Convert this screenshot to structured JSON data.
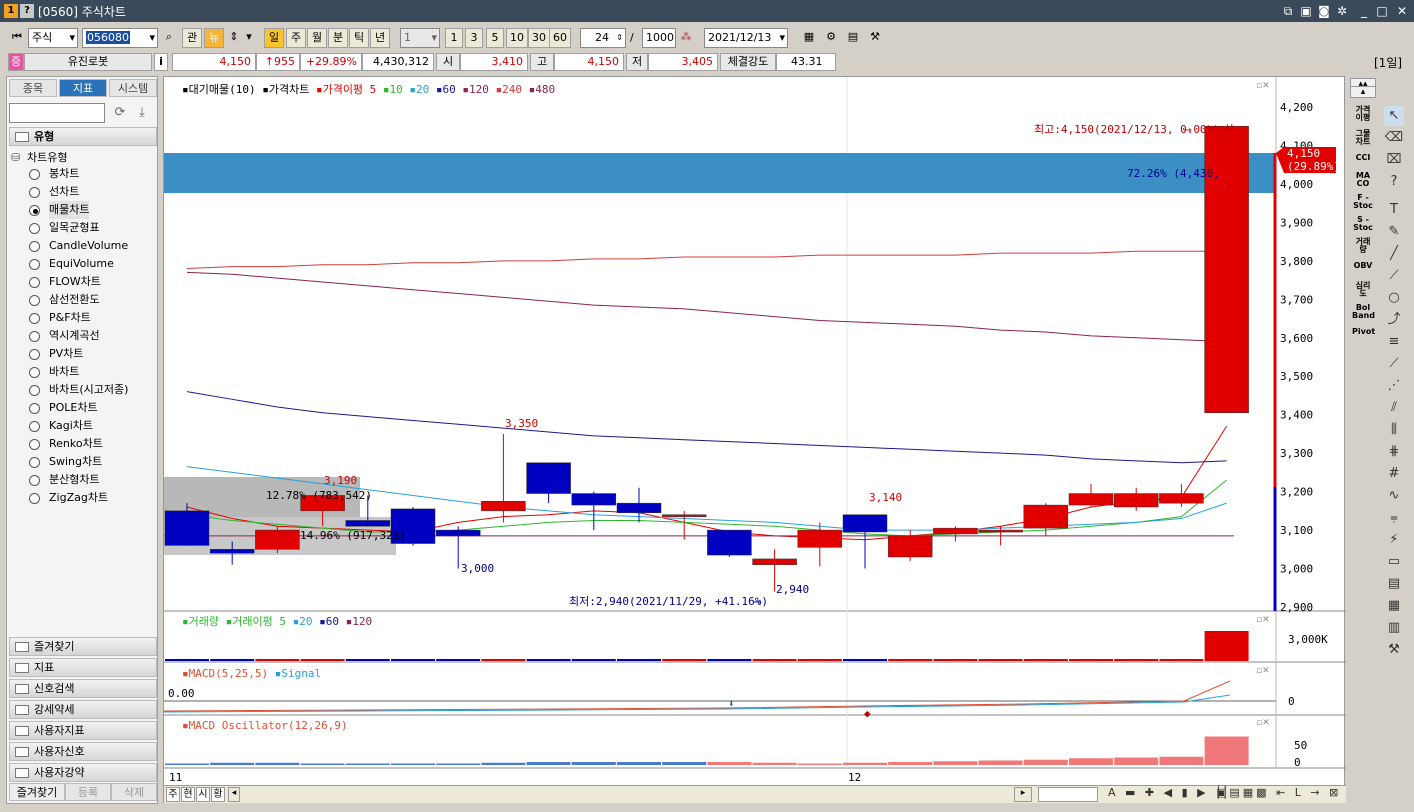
{
  "window": {
    "title": "[0560] 주식차트",
    "icon_labels": [
      "1",
      "?"
    ]
  },
  "toolbar": {
    "market": "주식",
    "code": "056080",
    "btn_gwan": "관",
    "btn_news": "뉴",
    "period_il": "일",
    "period_ju": "주",
    "period_wol": "월",
    "period_bun": "분",
    "period_tik": "틱",
    "period_nyeon": "년",
    "unit_select": "1",
    "units": [
      "1",
      "3",
      "5",
      "10",
      "30",
      "60"
    ],
    "count": "24",
    "separator": "/",
    "total": "1000",
    "date": "2021/12/13"
  },
  "quote": {
    "badge": "증",
    "name": "유진로봇",
    "info": "i",
    "price": "4,150",
    "change": "↑955",
    "change_pct": "+29.89%",
    "volume": "4,430,312",
    "open_label": "시",
    "open": "3,410",
    "high_label": "고",
    "high": "4,150",
    "low_label": "저",
    "low": "3,405",
    "strength_label": "체결강도",
    "strength": "43.31",
    "period_tag": "[1일]"
  },
  "left_panel": {
    "tabs": [
      "종목",
      "지표",
      "시스템"
    ],
    "section_title": "유형",
    "tree_root": "차트유형",
    "chart_types": [
      "봉차트",
      "선차트",
      "매물차트",
      "일목균형표",
      "CandleVolume",
      "EquiVolume",
      "FLOW차트",
      "삼선전환도",
      "P&F차트",
      "역시계곡선",
      "PV차트",
      "바차트",
      "바차트(시고저종)",
      "POLE차트",
      "Kagi차트",
      "Renko차트",
      "Swing차트",
      "분산형차트",
      "ZigZag차트"
    ],
    "selected_index": 2,
    "bottom_sections": [
      "즐겨찾기",
      "지표",
      "신호검색",
      "강세약세",
      "사용자지표",
      "사용자신호",
      "사용자강약"
    ],
    "bottom_buttons": [
      "즐겨찾기",
      "등록",
      "삭제"
    ]
  },
  "chart": {
    "legend_main": [
      "대기매물(10)",
      "가격차트",
      "가격이평 5",
      "10",
      "20",
      "60",
      "120",
      "240",
      "480"
    ],
    "legend_colors": [
      "#000000",
      "#000000",
      "#e60000",
      "#2db82d",
      "#2aa0d8",
      "#1a1a8c",
      "#8b2252",
      "#d23c3c",
      "#8b2252"
    ],
    "max_label": "최고:4,150(2021/12/13, 0.00%)",
    "max_tag": "상",
    "min_label": "최저:2,940(2021/11/29, +41.16%)",
    "current_price_tag": "4,150",
    "current_pct_tag": "(29.89%)",
    "band_top_label": "72.26% (4,430,",
    "band_mid_label": "12.78% (783,542)",
    "band_low_label": "14.96% (917,323)",
    "price_annotations": [
      "3,350",
      "3,190",
      "3,000",
      "2,940",
      "3,140"
    ],
    "y_ticks": [
      "4,200",
      "4,100",
      "4,000",
      "3,900",
      "3,800",
      "3,700",
      "3,600",
      "3,500",
      "3,400",
      "3,300",
      "3,200",
      "3,100",
      "3,000",
      "2,900"
    ],
    "x_labels": [
      "11",
      "12"
    ],
    "volume_legend": [
      "거래량",
      "거래이평 5",
      "20",
      "60",
      "120"
    ],
    "volume_tick": "3,000K",
    "macd_legend": [
      "MACD(5,25,5)",
      "Signal"
    ],
    "macd_zero_label": "0.00",
    "macd_tick": "0",
    "osc_legend": [
      "MACD Oscillator(12,26,9)"
    ],
    "osc_ticks": [
      "50",
      "0"
    ],
    "bottom_tabs": [
      "주",
      "현",
      "시",
      "황"
    ],
    "colors": {
      "up": "#e00000",
      "down": "#0000c0",
      "band": "#3b8fc4",
      "band_gray": "#b4b4b4"
    }
  },
  "chart_data": {
    "type": "candlestick",
    "title": "",
    "ylim": [
      2850,
      4250
    ],
    "candles": [
      {
        "o": 3150,
        "h": 3170,
        "l": 3060,
        "c": 3060
      },
      {
        "o": 3050,
        "h": 3070,
        "l": 3010,
        "c": 3040
      },
      {
        "o": 3050,
        "h": 3110,
        "l": 3040,
        "c": 3100
      },
      {
        "o": 3150,
        "h": 3190,
        "l": 3110,
        "c": 3190
      },
      {
        "o": 3125,
        "h": 3190,
        "l": 3110,
        "c": 3110
      },
      {
        "o": 3155,
        "h": 3160,
        "l": 3060,
        "c": 3065
      },
      {
        "o": 3100,
        "h": 3110,
        "l": 3000,
        "c": 3085
      },
      {
        "o": 3150,
        "h": 3350,
        "l": 3120,
        "c": 3175
      },
      {
        "o": 3275,
        "h": 3275,
        "l": 3170,
        "c": 3195
      },
      {
        "o": 3195,
        "h": 3200,
        "l": 3100,
        "c": 3165
      },
      {
        "o": 3170,
        "h": 3210,
        "l": 3120,
        "c": 3145
      },
      {
        "o": 3140,
        "h": 3150,
        "l": 3075,
        "c": 3140
      },
      {
        "o": 3100,
        "h": 3100,
        "l": 3030,
        "c": 3035
      },
      {
        "o": 3010,
        "h": 3050,
        "l": 2940,
        "c": 3025
      },
      {
        "o": 3055,
        "h": 3120,
        "l": 3005,
        "c": 3100
      },
      {
        "o": 3140,
        "h": 3140,
        "l": 3000,
        "c": 3095
      },
      {
        "o": 3030,
        "h": 3100,
        "l": 3020,
        "c": 3085
      },
      {
        "o": 3090,
        "h": 3110,
        "l": 3070,
        "c": 3105
      },
      {
        "o": 3095,
        "h": 3110,
        "l": 3060,
        "c": 3100
      },
      {
        "o": 3105,
        "h": 3170,
        "l": 3085,
        "c": 3165
      },
      {
        "o": 3165,
        "h": 3220,
        "l": 3160,
        "c": 3195
      },
      {
        "o": 3160,
        "h": 3210,
        "l": 3150,
        "c": 3195
      },
      {
        "o": 3170,
        "h": 3220,
        "l": 3160,
        "c": 3195
      },
      {
        "o": 3405,
        "h": 4150,
        "l": 3405,
        "c": 4150
      }
    ],
    "ma_lines": {
      "ma5": [
        3160,
        3130,
        3110,
        3105,
        3100,
        3095,
        3120,
        3135,
        3140,
        3150,
        3145,
        3120,
        3095,
        3085,
        3080,
        3075,
        3085,
        3095,
        3110,
        3130,
        3160,
        3175,
        3185,
        3370
      ],
      "ma10": [
        3140,
        3125,
        3115,
        3105,
        3095,
        3095,
        3100,
        3110,
        3120,
        3125,
        3125,
        3120,
        3115,
        3110,
        3100,
        3090,
        3085,
        3090,
        3095,
        3100,
        3110,
        3120,
        3135,
        3230
      ],
      "ma20": [
        3265,
        3250,
        3235,
        3220,
        3205,
        3190,
        3175,
        3160,
        3150,
        3140,
        3135,
        3130,
        3125,
        3120,
        3110,
        3100,
        3100,
        3100,
        3105,
        3110,
        3115,
        3120,
        3130,
        3170
      ],
      "ma60": [
        3460,
        3440,
        3420,
        3405,
        3395,
        3385,
        3375,
        3365,
        3355,
        3345,
        3340,
        3335,
        3330,
        3325,
        3320,
        3315,
        3310,
        3305,
        3300,
        3295,
        3285,
        3280,
        3275,
        3280
      ],
      "ma120": [
        3770,
        3765,
        3755,
        3745,
        3735,
        3725,
        3715,
        3705,
        3695,
        3685,
        3680,
        3675,
        3665,
        3655,
        3645,
        3640,
        3635,
        3630,
        3620,
        3615,
        3605,
        3600,
        3595,
        3590
      ],
      "ma240": [
        3780,
        3785,
        3785,
        3790,
        3790,
        3795,
        3795,
        3800,
        3800,
        3805,
        3805,
        3810,
        3810,
        3810,
        3815,
        3815,
        3815,
        3815,
        3820,
        3820,
        3820,
        3825,
        3825,
        3825
      ]
    },
    "volume_last": 4430312,
    "osc_values": [
      2,
      3,
      3,
      2,
      2,
      2,
      2,
      3,
      4,
      4,
      4,
      4,
      4,
      3,
      2,
      3,
      4,
      5,
      6,
      7,
      9,
      10,
      11,
      38
    ]
  }
}
